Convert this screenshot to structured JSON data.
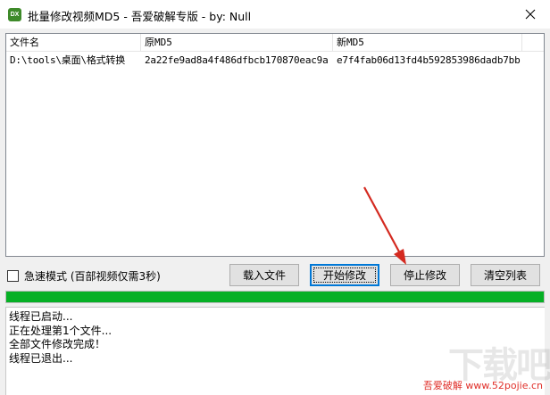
{
  "window": {
    "title": "批量修改视频MD5 - 吾爱破解专版 - by: Null",
    "app_icon_text": "DX"
  },
  "table": {
    "columns": [
      "文件名",
      "原MD5",
      "新MD5"
    ],
    "rows": [
      {
        "filename": "D:\\tools\\桌面\\格式转换",
        "old_md5": "2a22fe9ad8a4f486dfbcb170870eac9a",
        "new_md5": "e7f4fab06d13fd4b592853986dadb7bb"
      }
    ]
  },
  "options": {
    "fast_mode_label": "急速模式 (百部视频仅需3秒)",
    "fast_mode_checked": false
  },
  "buttons": {
    "load": "载入文件",
    "start": "开始修改",
    "stop": "停止修改",
    "clear": "清空列表"
  },
  "progress": {
    "percent": 100,
    "color": "#06b025"
  },
  "log": [
    "线程已启动...",
    "正在处理第1个文件...",
    "全部文件修改完成！",
    "线程已退出..."
  ],
  "watermark": {
    "logo_text": "下载吧",
    "site_text": "吾爱破解 www.52pojie.cn"
  },
  "colors": {
    "annotation_arrow": "#d42a20",
    "focus_border": "#0078d7"
  }
}
